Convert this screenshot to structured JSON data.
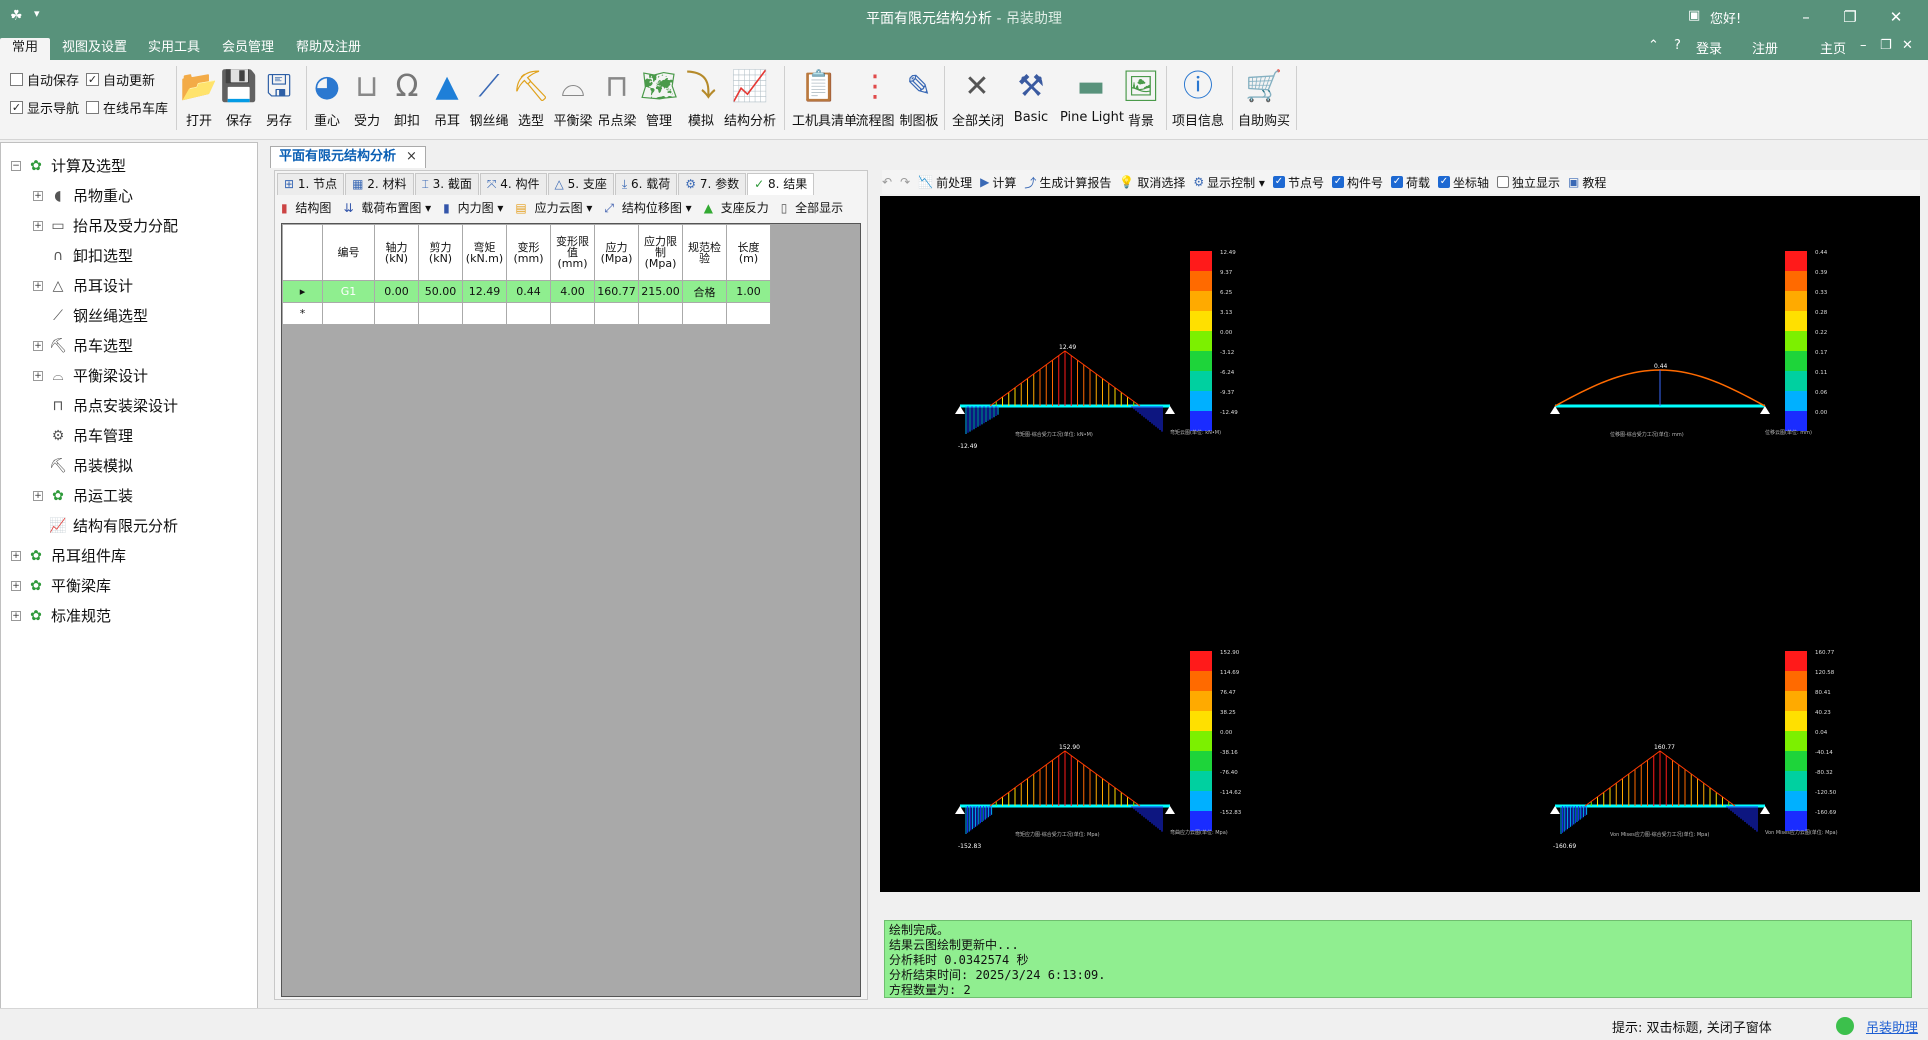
{
  "title": {
    "main": "平面有限元结构分析",
    "sub": " - 吊装助理",
    "hello": "您好!"
  },
  "menu": {
    "tabs": [
      "常用",
      "视图及设置",
      "实用工具",
      "会员管理",
      "帮助及注册"
    ],
    "right": [
      "登录",
      "注册",
      "主页"
    ]
  },
  "ribbon": {
    "checks": [
      {
        "label": "自动保存",
        "checked": false
      },
      {
        "label": "自动更新",
        "checked": true
      },
      {
        "label": "显示导航",
        "checked": true
      },
      {
        "label": "在线吊车库",
        "checked": false
      }
    ],
    "buttons": [
      "打开",
      "保存",
      "另存",
      "重心",
      "受力",
      "卸扣",
      "吊耳",
      "钢丝绳",
      "选型",
      "平衡梁",
      "吊点梁",
      "管理",
      "模拟",
      "结构分析",
      "工机具清单",
      "流程图",
      "制图板",
      "全部关闭",
      "Basic",
      "Pine Light",
      "背景",
      "项目信息",
      "自助购买"
    ]
  },
  "tree": {
    "nodes": [
      {
        "label": "计算及选型",
        "level": 0,
        "exp": "-"
      },
      {
        "label": "吊物重心",
        "level": 1,
        "exp": "+"
      },
      {
        "label": "抬吊及受力分配",
        "level": 1,
        "exp": "+"
      },
      {
        "label": "卸扣选型",
        "level": 1,
        "exp": ""
      },
      {
        "label": "吊耳设计",
        "level": 1,
        "exp": "+"
      },
      {
        "label": "钢丝绳选型",
        "level": 1,
        "exp": ""
      },
      {
        "label": "吊车选型",
        "level": 1,
        "exp": "+"
      },
      {
        "label": "平衡梁设计",
        "level": 1,
        "exp": "+"
      },
      {
        "label": "吊点安装梁设计",
        "level": 1,
        "exp": ""
      },
      {
        "label": "吊车管理",
        "level": 1,
        "exp": ""
      },
      {
        "label": "吊装模拟",
        "level": 1,
        "exp": ""
      },
      {
        "label": "吊运工装",
        "level": 1,
        "exp": "+"
      },
      {
        "label": "结构有限元分析",
        "level": 1,
        "exp": ""
      },
      {
        "label": "吊耳组件库",
        "level": 0,
        "exp": "+"
      },
      {
        "label": "平衡梁库",
        "level": 0,
        "exp": "+"
      },
      {
        "label": "标准规范",
        "level": 0,
        "exp": "+"
      }
    ]
  },
  "doc_tab": {
    "label": "平面有限元结构分析",
    "close": "×"
  },
  "sub_tabs": [
    "1. 节点",
    "2. 材料",
    "3. 截面",
    "4. 构件",
    "5. 支座",
    "6. 载荷",
    "7. 参数",
    "8. 结果"
  ],
  "sub_tools": [
    "结构图",
    "载荷布置图 ▾",
    "内力图 ▾",
    "应力云图 ▾",
    "结构位移图 ▾",
    "支座反力",
    "全部显示"
  ],
  "grid": {
    "headers": [
      "编号",
      "轴力(kN)",
      "剪力(kN)",
      "弯矩(kN.m)",
      "变形(mm)",
      "变形限值(mm)",
      "应力(Mpa)",
      "应力限制(Mpa)",
      "规范检验",
      "长度(m)"
    ],
    "rows": [
      [
        "G1",
        "0.00",
        "50.00",
        "12.49",
        "0.44",
        "4.00",
        "160.77",
        "215.00",
        "合格",
        "1.00"
      ]
    ]
  },
  "right_tools": [
    {
      "label": "前处理",
      "type": "btn"
    },
    {
      "label": "计算",
      "type": "btn"
    },
    {
      "label": "生成计算报告",
      "type": "btn"
    },
    {
      "label": "取消选择",
      "type": "btn"
    },
    {
      "label": "显示控制 ▾",
      "type": "btn"
    },
    {
      "label": "节点号",
      "type": "check",
      "checked": true
    },
    {
      "label": "构件号",
      "type": "check",
      "checked": true
    },
    {
      "label": "荷载",
      "type": "check",
      "checked": true
    },
    {
      "label": "坐标轴",
      "type": "check",
      "checked": true
    },
    {
      "label": "独立显示",
      "type": "check",
      "checked": false
    },
    {
      "label": "教程",
      "type": "btn"
    }
  ],
  "plots": [
    {
      "peak": "12.49",
      "minlabel": "-12.49",
      "caption": "弯矩图-综合受力工况(单位: kN•M)",
      "legend_title": "弯矩云图(单位: kN•M)",
      "ticks": [
        "12.49",
        "9.37",
        "6.25",
        "3.13",
        "0.00",
        "-3.12",
        "-6.24",
        "-9.37",
        "-12.49"
      ]
    },
    {
      "peak": "0.44",
      "minlabel": "",
      "caption": "位移图-综合受力工况(单位: mm)",
      "legend_title": "位移云图(单位: mm)",
      "ticks": [
        "0.44",
        "0.39",
        "0.33",
        "0.28",
        "0.22",
        "0.17",
        "0.11",
        "0.06",
        "0.00"
      ]
    },
    {
      "peak": "152.90",
      "minlabel": "-152.83",
      "caption": "弯矩应力图-综合受力工况(单位: Mpa)",
      "legend_title": "弯曲应力云图(单位: Mpa)",
      "ticks": [
        "152.90",
        "114.69",
        "76.47",
        "38.25",
        "0.00",
        "-38.16",
        "-76.40",
        "-114.62",
        "-152.83"
      ]
    },
    {
      "peak": "160.77",
      "minlabel": "-160.69",
      "caption": "Von Mises应力图-综合受力工况(单位: Mpa)",
      "legend_title": "Von Mises应力云图(单位: Mpa)",
      "ticks": [
        "160.77",
        "120.58",
        "80.41",
        "40.23",
        "0.04",
        "-40.14",
        "-80.32",
        "-120.50",
        "-160.69"
      ]
    }
  ],
  "log": {
    "lines": [
      "绘制完成。",
      "结果云图绘制更新中...",
      " 分析耗时 0.0342574 秒",
      " 分析结束时间: 2025/3/24 6:13:09.",
      " 方程数量为: 2"
    ]
  },
  "status": {
    "hint": "提示: 双击标题, 关闭子窗体",
    "link": "吊装助理"
  },
  "colors": {
    "accent": "#58927b",
    "row_ok": "#8fee8f",
    "log_bg": "#90ee90"
  }
}
